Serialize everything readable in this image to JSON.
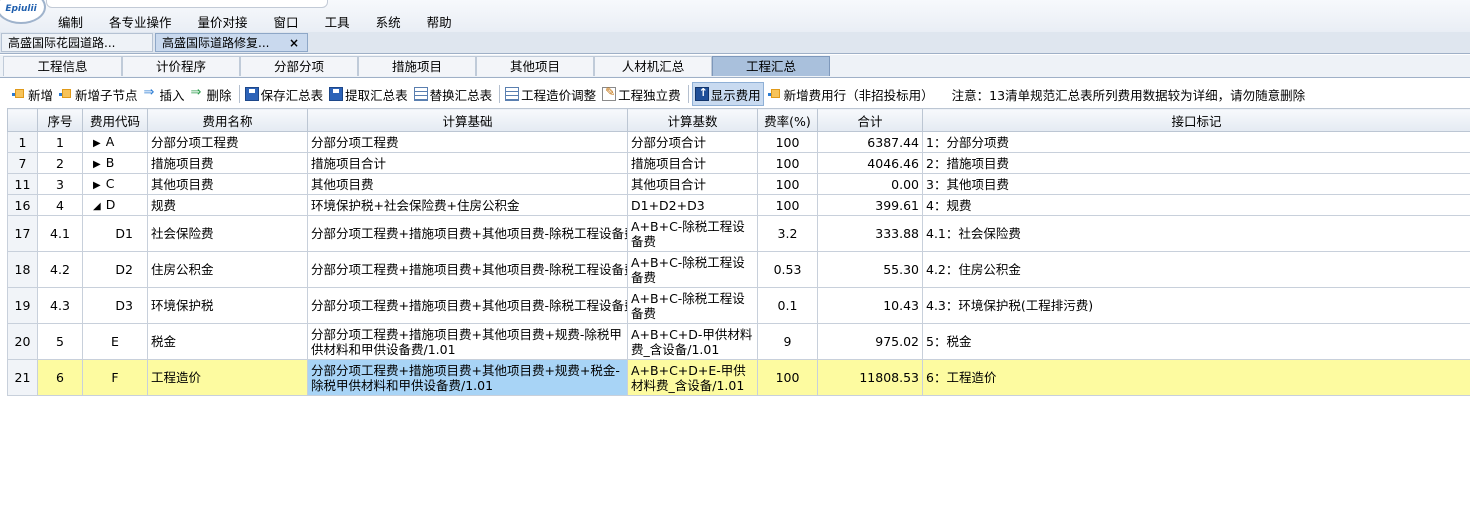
{
  "app": {
    "logo_text": "Epiulii",
    "menu": [
      "编制",
      "各专业操作",
      "量价对接",
      "窗口",
      "工具",
      "系统",
      "帮助"
    ]
  },
  "doc_tabs": [
    {
      "label": "高盛国际花园道路...",
      "active": false
    },
    {
      "label": "高盛国际道路修复...",
      "active": true,
      "close": "×"
    }
  ],
  "module_tabs": [
    {
      "label": "工程信息",
      "active": false
    },
    {
      "label": "计价程序",
      "active": false
    },
    {
      "label": "分部分项",
      "active": false
    },
    {
      "label": "措施项目",
      "active": false
    },
    {
      "label": "其他项目",
      "active": false
    },
    {
      "label": "人材机汇总",
      "active": false
    },
    {
      "label": "工程汇总",
      "active": true
    }
  ],
  "toolbar": {
    "add": "新增",
    "add_child": "新增子节点",
    "insert": "插入",
    "delete": "删除",
    "save_summary": "保存汇总表",
    "extract_summary": "提取汇总表",
    "replace_summary": "替换汇总表",
    "cost_adjust": "工程造价调整",
    "independent_fee": "工程独立费",
    "show_fee": "显示费用",
    "add_fee_row": "新增费用行（非招投标用）",
    "note": "注意：13清单规范汇总表所列费用数据较为详细，请勿随意删除"
  },
  "table": {
    "headers": [
      "",
      "序号",
      "费用代码",
      "费用名称",
      "计算基础",
      "计算基数",
      "费率(%)",
      "合计",
      "接口标记"
    ],
    "rows": [
      {
        "row": "1",
        "seq": "1",
        "code": "A",
        "tree": "▶",
        "name": "分部分项工程费",
        "basis": "分部分项工程费",
        "base": "分部分项合计",
        "rate": "100",
        "total": "6387.44",
        "mark": "1：分部分项费"
      },
      {
        "row": "7",
        "seq": "2",
        "code": "B",
        "tree": "▶",
        "name": "措施项目费",
        "basis": "措施项目合计",
        "base": "措施项目合计",
        "rate": "100",
        "total": "4046.46",
        "mark": "2：措施项目费"
      },
      {
        "row": "11",
        "seq": "3",
        "code": "C",
        "tree": "▶",
        "name": "其他项目费",
        "basis": "其他项目费",
        "base": "其他项目合计",
        "rate": "100",
        "total": "0.00",
        "mark": "3：其他项目费"
      },
      {
        "row": "16",
        "seq": "4",
        "code": "D",
        "tree": "◢",
        "name": "规费",
        "basis": "环境保护税+社会保险费+住房公积金",
        "base": "D1+D2+D3",
        "rate": "100",
        "total": "399.61",
        "mark": "4：规费"
      },
      {
        "row": "17",
        "seq": "4.1",
        "code": "D1",
        "tree": "",
        "name": "社会保险费",
        "basis": "分部分项工程费+措施项目费+其他项目费-除税工程设备费",
        "base": "A+B+C-除税工程设备费",
        "rate": "3.2",
        "total": "333.88",
        "mark": "4.1：社会保险费"
      },
      {
        "row": "18",
        "seq": "4.2",
        "code": "D2",
        "tree": "",
        "name": "住房公积金",
        "basis": "分部分项工程费+措施项目费+其他项目费-除税工程设备费",
        "base": "A+B+C-除税工程设备费",
        "rate": "0.53",
        "total": "55.30",
        "mark": "4.2：住房公积金"
      },
      {
        "row": "19",
        "seq": "4.3",
        "code": "D3",
        "tree": "",
        "name": "环境保护税",
        "basis": "分部分项工程费+措施项目费+其他项目费-除税工程设备费",
        "base": "A+B+C-除税工程设备费",
        "rate": "0.1",
        "total": "10.43",
        "mark": "4.3：环境保护税(工程排污费)"
      },
      {
        "row": "20",
        "seq": "5",
        "code": "E",
        "tree": "",
        "name": "税金",
        "basis": "分部分项工程费+措施项目费+其他项目费+规费-除税甲供材料和甲供设备费/1.01",
        "base": "A+B+C+D-甲供材料费_含设备/1.01",
        "rate": "9",
        "total": "975.02",
        "mark": "5：税金"
      },
      {
        "row": "21",
        "seq": "6",
        "code": "F",
        "tree": "",
        "name": "工程造价",
        "basis": "分部分项工程费+措施项目费+其他项目费+规费+税金-除税甲供材料和甲供设备费/1.01",
        "base": "A+B+C+D+E-甲供材料费_含设备/1.01",
        "rate": "100",
        "total": "11808.53",
        "mark": "6：工程造价",
        "selected": true
      }
    ]
  }
}
